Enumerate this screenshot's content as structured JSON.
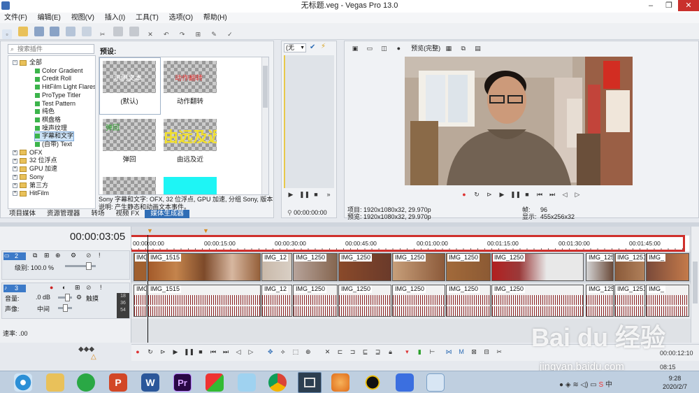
{
  "window": {
    "title": "无标题.veg - Vegas Pro 13.0",
    "controls": [
      "–",
      "❐",
      "✕"
    ]
  },
  "menu": [
    "文件(F)",
    "编辑(E)",
    "视图(V)",
    "插入(I)",
    "工具(T)",
    "选项(O)",
    "帮助(H)"
  ],
  "plugins": {
    "search_placeholder": "搜索插件",
    "tree": [
      {
        "label": "全部",
        "type": "folder",
        "expanded": true
      },
      {
        "label": "Color Gradient",
        "type": "item"
      },
      {
        "label": "Credit Roll",
        "type": "item"
      },
      {
        "label": "HitFilm Light Flares",
        "type": "item"
      },
      {
        "label": "ProType Titler",
        "type": "item"
      },
      {
        "label": "Test Pattern",
        "type": "item"
      },
      {
        "label": "纯色",
        "type": "item"
      },
      {
        "label": "棋盘格",
        "type": "item"
      },
      {
        "label": "噪声纹理",
        "type": "item"
      },
      {
        "label": "字幕和文字",
        "type": "item",
        "selected": true
      },
      {
        "label": "(自带) Text",
        "type": "item"
      },
      {
        "label": "OFX",
        "type": "folder"
      },
      {
        "label": "32 位浮点",
        "type": "folder"
      },
      {
        "label": "GPU 加速",
        "type": "folder"
      },
      {
        "label": "Sony",
        "type": "folder"
      },
      {
        "label": "第三方",
        "type": "folder"
      },
      {
        "label": "HitFilm",
        "type": "folder"
      }
    ],
    "presets_header": "预设:",
    "presets": [
      {
        "thumb_text": "示例文本",
        "label": "(默认)",
        "selected": true
      },
      {
        "thumb_text": "动作翻转",
        "label": "动作翻转"
      },
      {
        "thumb_text": "弹回",
        "label": "弹回"
      },
      {
        "thumb_text": "由远及近",
        "label": "由远及近"
      },
      {
        "thumb_text": "",
        "label": ""
      },
      {
        "thumb_text": "",
        "label": ""
      }
    ],
    "description_line1": "Sony 字幕和文字: OFX, 32 位浮点, GPU 加速, 分组 Sony, 版本",
    "description_line2": "说明: 产生静态和动画文本事件。",
    "tabs": [
      "项目媒体",
      "资源管理器",
      "转场",
      "视频 FX",
      "媒体生成器"
    ],
    "active_tab": "媒体生成器"
  },
  "trimmer": {
    "dropdown": "(无",
    "timecode": "00:00:00:00"
  },
  "preview": {
    "quality": "预览(完整)",
    "project": "项目: 1920x1080x32, 29.970p",
    "preview_res": "预览: 1920x1080x32, 29.970p",
    "frame_label": "帧:",
    "frame_value": "96",
    "display_label": "显示:",
    "display_value": "455x256x32"
  },
  "timeline": {
    "timecode": "00:00:03:05",
    "ruler_ticks": [
      "00:00:00:00",
      "00:00:15:00",
      "00:00:30:00",
      "00:00:45:00",
      "00:01:00:00",
      "00:01:15:00",
      "00:01:30:00",
      "00:01:45:00"
    ],
    "video_track": {
      "number": "2",
      "level_label": "级别: 100.0 %"
    },
    "audio_track": {
      "number": "3",
      "volume_label": "音量:",
      "volume_value": ".0 dB",
      "pan_label": "声像:",
      "pan_value": "中间",
      "touch": "触摸",
      "meter": [
        "18",
        "36",
        "54"
      ]
    },
    "video_clips": [
      "IMG",
      "IMG_1515",
      "IMG_12",
      "IMG_1250",
      "IMG_1250",
      "IMG_1250",
      "IMG_1250",
      "IMG_1250",
      "IMG_125",
      "IMG_1251",
      "IMG_"
    ],
    "audio_clips": [
      "IMG",
      "IMG_1515",
      "IMG_12",
      "IMG_1250",
      "IMG_1250",
      "IMG_1250",
      "IMG_1250",
      "IMG_1250",
      "IMG_125",
      "IMG_1251",
      "IMG_"
    ],
    "rate_label": "速率: .00",
    "end_time": "00:00:12:10"
  },
  "taskbar": {
    "clock_time": "9:28",
    "clock_date": "2020/2/7",
    "small_time": "08:15"
  },
  "watermark": {
    "brand": "Bai du 经验",
    "url": "jingyan.baidu.com"
  },
  "colors": {
    "accent": "#3c7ac8",
    "highlight_box": "#d0302c",
    "tab_active": "#2f6db5",
    "clip_brown": "#a0602f",
    "wave": "#8b2222"
  }
}
